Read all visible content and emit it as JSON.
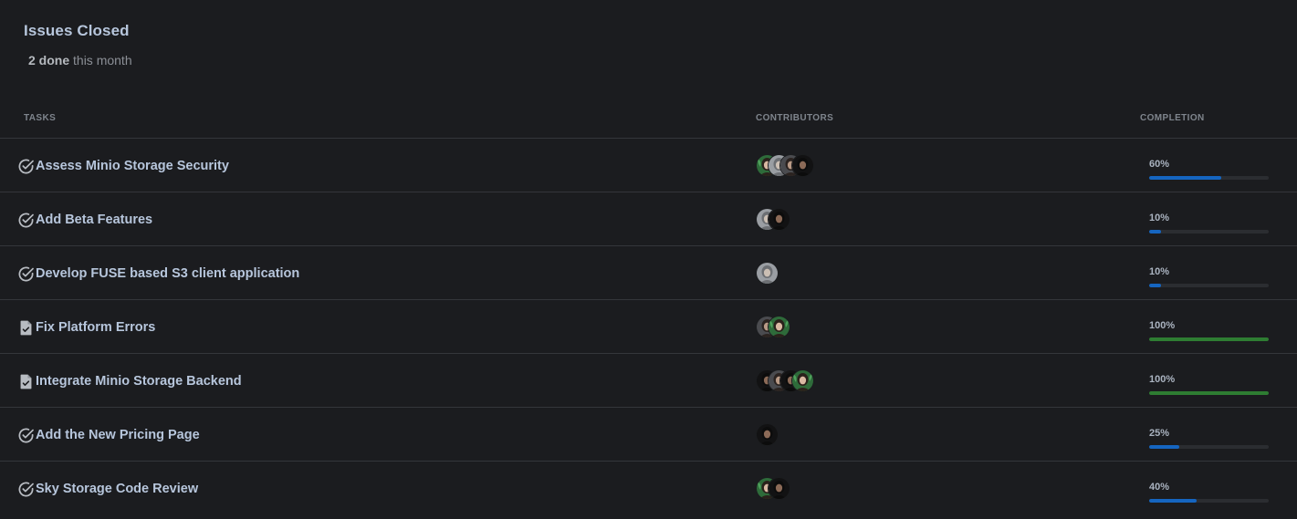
{
  "card": {
    "title": "Issues Closed",
    "done_count": "2 done",
    "done_suffix": " this month"
  },
  "columns": {
    "tasks": "TASKS",
    "contributors": "CONTRIBUTORS",
    "completion": "COMPLETION"
  },
  "colors": {
    "progress_blue": "#1565c0",
    "progress_green": "#2e7d32"
  },
  "tasks": [
    {
      "name": "Assess Minio Storage Security",
      "icon": "check-circle-icon",
      "contributors": [
        "plant-woman",
        "gray-man",
        "dark-hair-woman",
        "dark-man"
      ],
      "completion_label": "60%",
      "completion": 60,
      "status": "in-progress"
    },
    {
      "name": "Add Beta Features",
      "icon": "check-circle-icon",
      "contributors": [
        "gray-man",
        "dark-man"
      ],
      "completion_label": "10%",
      "completion": 10,
      "status": "in-progress"
    },
    {
      "name": "Develop FUSE based S3 client application",
      "icon": "check-circle-icon",
      "contributors": [
        "gray-man"
      ],
      "completion_label": "10%",
      "completion": 10,
      "status": "in-progress"
    },
    {
      "name": "Fix Platform Errors",
      "icon": "file-check-icon",
      "contributors": [
        "dark-hair-woman",
        "plant-woman"
      ],
      "completion_label": "100%",
      "completion": 100,
      "status": "done"
    },
    {
      "name": "Integrate Minio Storage Backend",
      "icon": "file-check-icon",
      "contributors": [
        "dark-man",
        "dark-hair-woman",
        "dark-man",
        "plant-woman"
      ],
      "completion_label": "100%",
      "completion": 100,
      "status": "done"
    },
    {
      "name": "Add the New Pricing Page",
      "icon": "check-circle-icon",
      "contributors": [
        "dark-man"
      ],
      "completion_label": "25%",
      "completion": 25,
      "status": "in-progress"
    },
    {
      "name": "Sky Storage Code Review",
      "icon": "check-circle-icon",
      "contributors": [
        "plant-woman",
        "dark-man"
      ],
      "completion_label": "40%",
      "completion": 40,
      "status": "in-progress"
    }
  ]
}
